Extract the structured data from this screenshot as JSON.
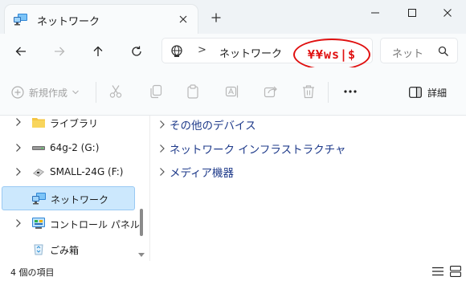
{
  "window": {
    "tab_title": "ネットワーク",
    "new_tab_symbol": "+"
  },
  "address": {
    "separator": ">",
    "location": "ネットワーク",
    "annotation": "¥¥ws|$"
  },
  "search": {
    "placeholder": "ネットワ"
  },
  "toolbar": {
    "new_label": "新規作成",
    "details_label": "詳細"
  },
  "sidebar": {
    "items": [
      {
        "label": "ライブラリ",
        "icon": "library-folder-icon",
        "has_chevron": true,
        "selected": false
      },
      {
        "label": "64g-2 (G:)",
        "icon": "usb-drive-icon",
        "has_chevron": true,
        "selected": false
      },
      {
        "label": "SMALL-24G (F:)",
        "icon": "removable-drive-icon",
        "has_chevron": true,
        "selected": false
      },
      {
        "label": "ネットワーク",
        "icon": "network-icon",
        "has_chevron": false,
        "selected": true
      },
      {
        "label": "コントロール パネル",
        "icon": "control-panel-icon",
        "has_chevron": true,
        "selected": false
      },
      {
        "label": "ごみ箱",
        "icon": "recycle-bin-icon",
        "has_chevron": false,
        "selected": false
      }
    ]
  },
  "content": {
    "groups": [
      {
        "label": "その他のデバイス"
      },
      {
        "label": "ネットワーク インフラストラクチャ"
      },
      {
        "label": "メディア機器"
      }
    ]
  },
  "status": {
    "item_count": "4 個の項目"
  },
  "colors": {
    "selection_bg": "#cce8fd",
    "selection_border": "#99c9f3",
    "group_text": "#1e3a8a",
    "annotation": "#e01010",
    "chrome_bg": "#eff3f6"
  }
}
